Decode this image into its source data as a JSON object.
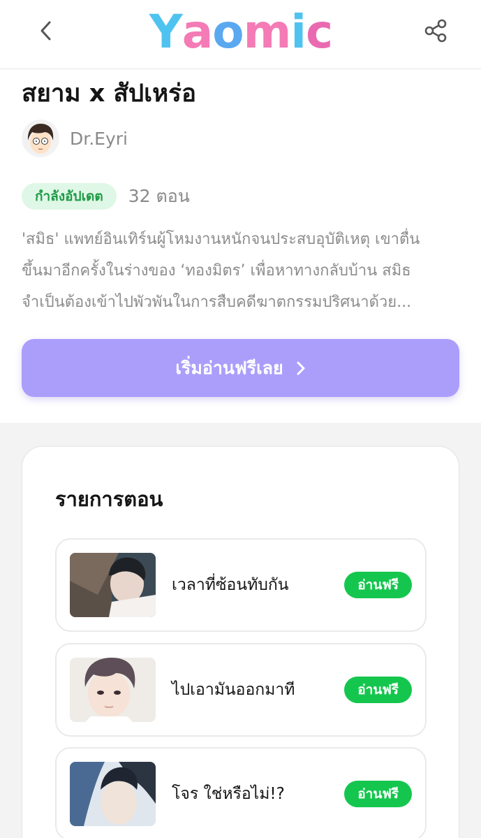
{
  "header": {
    "logo_letters": [
      "Y",
      "a",
      "o",
      "m",
      "i",
      "c"
    ],
    "logo_colors": [
      "#4fc3f0",
      "#f47bb5",
      "#5aa8f0",
      "#f47bb5",
      "#4fc3f0",
      "#e96ab0"
    ],
    "back_icon": "chevron-left-icon",
    "share_icon": "share-icon"
  },
  "comic": {
    "title": "สยาม x สัปเหร่อ",
    "author": "Dr.Eyri",
    "status": "กำลังอัปเดต",
    "episode_count": "32 ตอน",
    "synopsis_lines": [
      "'สมิธ' แพทย์อินเทิร์นผู้โหมงานหนักจนประสบอุบัติเหตุ เขาตื่น",
      "ขึ้นมาอีกครั้งในร่างของ ‘ทองมิตร’ เพื่อหาทางกลับบ้าน สมิธ",
      "จำเป็นต้องเข้าไปพัวพันในการสืบคดีฆาตกรรมปริศนาด้วย..."
    ],
    "read_button": "เริ่มอ่านฟรีเลย"
  },
  "episodes": {
    "heading": "รายการตอน",
    "items": [
      {
        "title": "เวลาที่ซ้อนทับกัน",
        "badge": "อ่านฟรี"
      },
      {
        "title": "ไปเอามันออกมาที",
        "badge": "อ่านฟรี"
      },
      {
        "title": "โจร ใช่หรือไม่!?",
        "badge": "อ่านฟรี"
      }
    ]
  },
  "colors": {
    "accent_button": "#ab9efb",
    "free_badge": "#15c64e",
    "status_badge_bg": "#dff7e6",
    "status_badge_text": "#1f9a47"
  }
}
